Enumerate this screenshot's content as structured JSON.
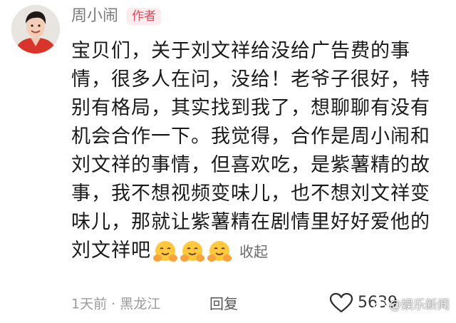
{
  "comment": {
    "username": "周小闹",
    "author_badge": "作者",
    "lines": [
      "宝贝们，关于刘文祥给没给广告费的事",
      "情，很多人在问，没给！老爷子很好，特",
      "别有格局，其实找到我了，想聊聊有没有",
      "机会合作一下。我觉得，合作是周小闹和",
      "刘文祥的事情，但喜欢吃，是紫薯精的故",
      "事，我不想视频变味儿，也不想刘文祥变",
      "味儿，那就让紫薯精在剧情里好好爱他的",
      "刘文祥吧"
    ],
    "emojis": [
      "hugging-face-emoji",
      "hugging-face-emoji",
      "hugging-face-emoji"
    ],
    "collapse_label": "收起",
    "time": "1天前",
    "separator": "·",
    "location": "黑龙江",
    "reply_label": "回复",
    "like_count": "5639",
    "like_icon": "heart-outline-icon"
  },
  "watermark": {
    "text": "@娱乐新闻",
    "logo": "weibo-logo-icon"
  },
  "colors": {
    "author_badge_bg": "#fdecee",
    "author_badge_text": "#f0445b",
    "secondary_text": "#9a9a9a"
  }
}
